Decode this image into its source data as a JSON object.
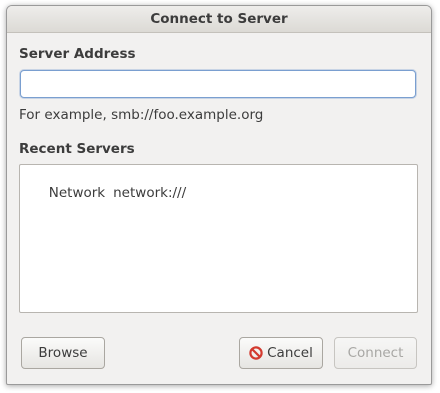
{
  "window": {
    "title": "Connect to Server"
  },
  "server_address": {
    "label": "Server Address",
    "value": "",
    "placeholder": "",
    "hint": "For example, smb://foo.example.org"
  },
  "recent_servers": {
    "label": "Recent Servers",
    "items": [
      {
        "name": "Network",
        "uri": "network:///"
      }
    ]
  },
  "buttons": {
    "browse": "Browse",
    "cancel": "Cancel",
    "connect": "Connect",
    "connect_enabled": false
  },
  "colors": {
    "cancel_icon": "#d33a2f",
    "input_focus_border": "#7a9fd0",
    "dialog_bg": "#f2f1f0"
  },
  "icons": {
    "cancel": "cancel-icon"
  }
}
